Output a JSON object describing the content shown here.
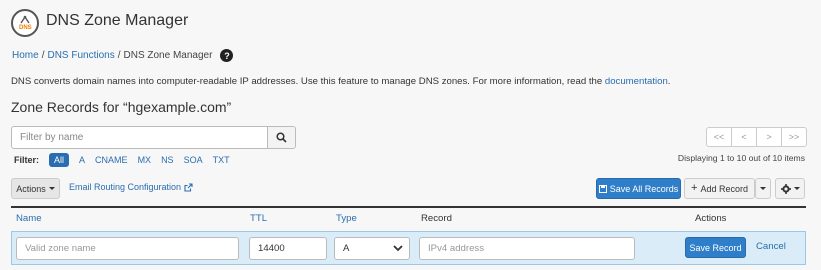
{
  "header": {
    "title": "DNS Zone Manager",
    "logo_text": "DNS"
  },
  "breadcrumb": {
    "items": [
      "Home",
      "DNS Functions",
      "DNS Zone Manager"
    ],
    "separator": "/"
  },
  "description": {
    "text": "DNS converts domain names into computer-readable IP addresses. Use this feature to manage DNS zones. For more information, read the ",
    "link": "documentation",
    "end": "."
  },
  "section": {
    "title": "Zone Records for “hgexample.com”"
  },
  "search": {
    "placeholder": "Filter by name"
  },
  "filter": {
    "label": "Filter:",
    "options": [
      "All",
      "A",
      "CNAME",
      "MX",
      "NS",
      "SOA",
      "TXT"
    ],
    "selected": "All"
  },
  "pagination": {
    "buttons": [
      "<<",
      "<",
      ">",
      ">>"
    ],
    "summary": "Displaying 1 to 10 out of 10 items"
  },
  "toolbar": {
    "actions_label": "Actions",
    "email_routing_label": "Email Routing Configuration",
    "save_all_label": "Save All Records",
    "add_record_label": "Add Record"
  },
  "table": {
    "columns": [
      "Name",
      "TTL",
      "Type",
      "Record",
      "Actions"
    ]
  },
  "edit_row": {
    "name_placeholder": "Valid zone name",
    "ttl_value": "14400",
    "type_value": "A",
    "record_placeholder": "IPv4 address",
    "save_label": "Save Record",
    "cancel_label": "Cancel"
  },
  "colors": {
    "primary": "#2f7ec9",
    "link": "#2a6db0",
    "edit_row_bg": "#d9ecf8",
    "logo_accent": "#f57c00"
  }
}
